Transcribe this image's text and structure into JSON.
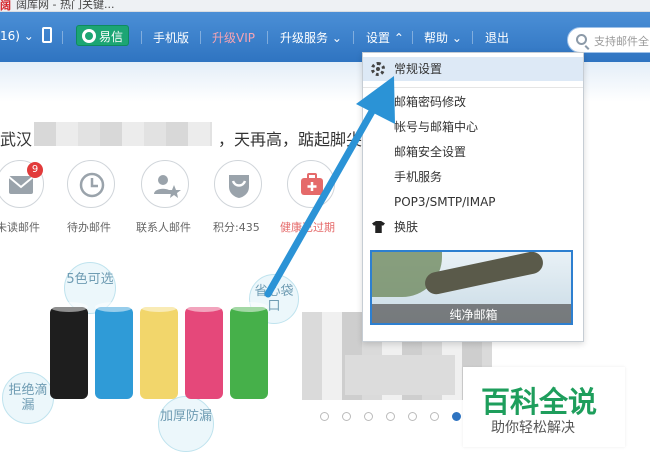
{
  "browser": {
    "tab_title": "阔库网 - 热门关键..."
  },
  "topbar": {
    "count_label": "16)",
    "yixin_label": "易信",
    "mobile_label": "手机版",
    "vip_label": "升级VIP",
    "upgrade_label": "升级服务",
    "settings_label": "设置",
    "help_label": "帮助",
    "logout_label": "退出",
    "search_placeholder": "支持邮件全",
    "colors": {
      "bar": "#3a80cc",
      "vip": "#f28da0",
      "yixin": "#1ca574"
    }
  },
  "greeting": {
    "prefix": "武汉",
    "suffix": "，天再高，踮起脚尖"
  },
  "quick_icons": [
    {
      "label": "未读邮件",
      "icon": "envelope-icon",
      "badge": "9"
    },
    {
      "label": "待办邮件",
      "icon": "clock-icon"
    },
    {
      "label": "联系人邮件",
      "icon": "contact-star-icon"
    },
    {
      "label": "积分:435",
      "icon": "points-shield-icon"
    },
    {
      "label": "健康已过期",
      "icon": "health-kit-icon"
    }
  ],
  "promo": {
    "bubbles": [
      "5色可选",
      "省心袋口",
      "拒绝滴漏",
      "加厚防漏"
    ],
    "roll_colors": [
      "#1e1e1e",
      "#2f9bd7",
      "#f2d66b",
      "#e5487a",
      "#46b04a"
    ]
  },
  "settings_menu": {
    "items": [
      {
        "label": "常规设置",
        "icon": "gear-icon"
      },
      {
        "label": "邮箱密码修改"
      },
      {
        "label": "帐号与邮箱中心"
      },
      {
        "label": "邮箱安全设置"
      },
      {
        "label": "手机服务"
      },
      {
        "label": "POP3/SMTP/IMAP"
      },
      {
        "label": "换肤",
        "icon": "shirt-icon"
      }
    ],
    "skin_caption": "纯净邮箱"
  },
  "watermark": {
    "title": "百科全说",
    "subtitle": "助你轻松解决"
  }
}
